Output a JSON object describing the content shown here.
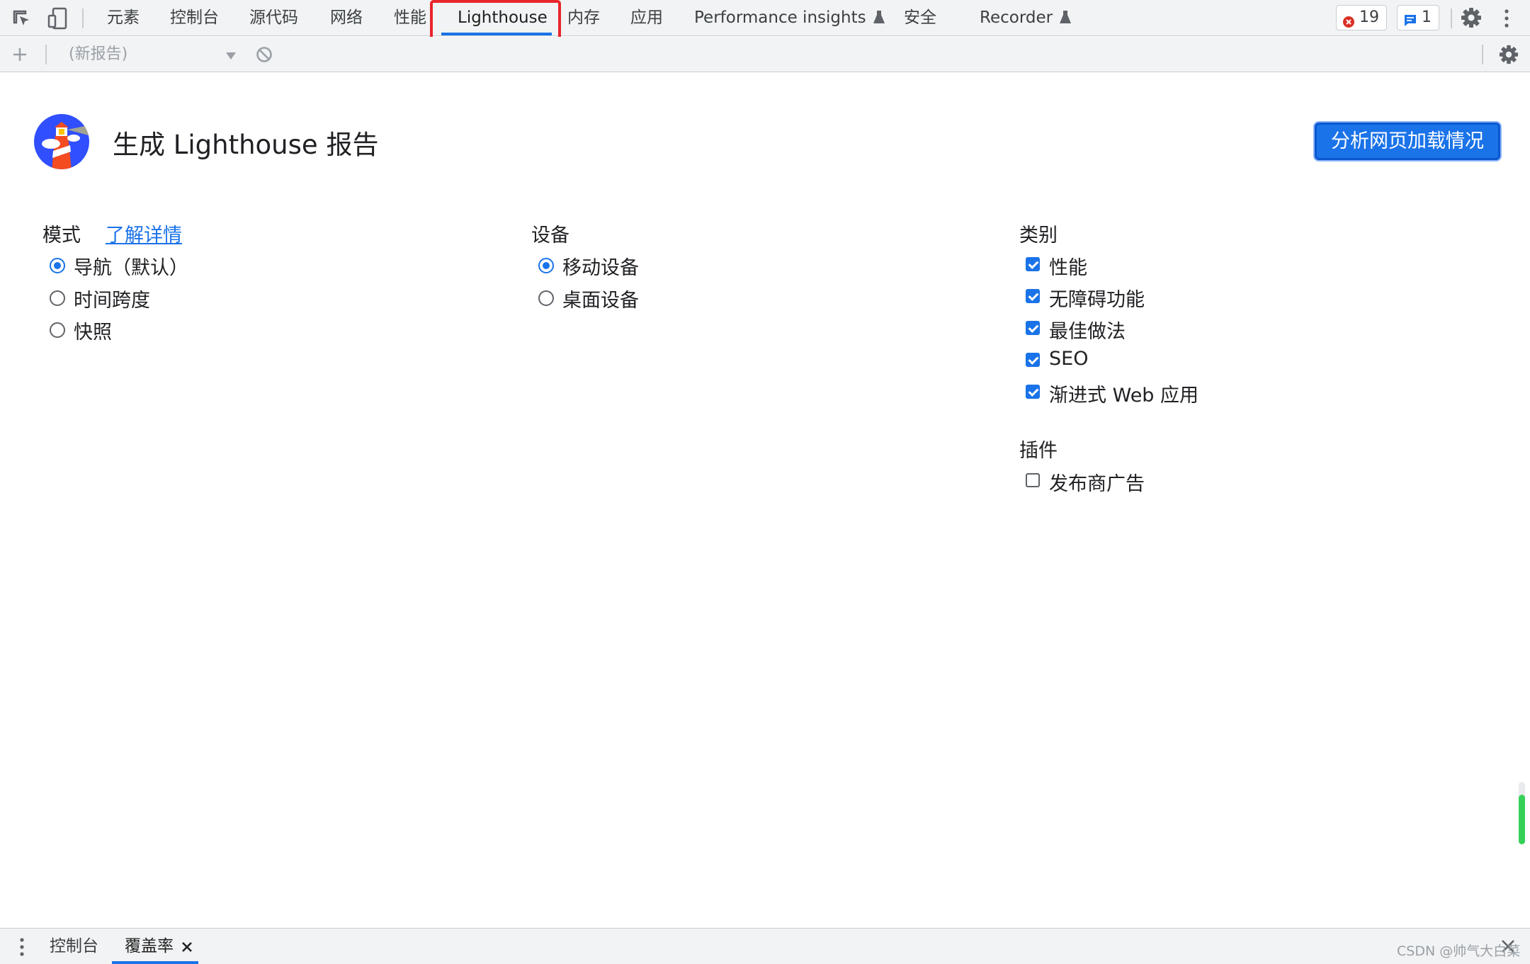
{
  "top_tabs": [
    {
      "label": "元素"
    },
    {
      "label": "控制台"
    },
    {
      "label": "源代码"
    },
    {
      "label": "网络"
    },
    {
      "label": "性能"
    },
    {
      "label": "Lighthouse",
      "active": true
    },
    {
      "label": "内存"
    },
    {
      "label": "应用"
    },
    {
      "label": "Performance insights",
      "experimental": true
    },
    {
      "label": "安全"
    },
    {
      "label": "Recorder",
      "experimental": true
    }
  ],
  "issues": {
    "errors": "19",
    "messages": "1"
  },
  "toolbar": {
    "report_select": "(新报告)"
  },
  "main": {
    "title": "生成 Lighthouse 报告",
    "analyze_button": "分析网页加载情况",
    "mode": {
      "label": "模式",
      "learn_more": "了解详情",
      "options": [
        {
          "label": "导航（默认）",
          "checked": true
        },
        {
          "label": "时间跨度",
          "checked": false
        },
        {
          "label": "快照",
          "checked": false
        }
      ]
    },
    "device": {
      "label": "设备",
      "options": [
        {
          "label": "移动设备",
          "checked": true
        },
        {
          "label": "桌面设备",
          "checked": false
        }
      ]
    },
    "categories": {
      "label": "类别",
      "items": [
        {
          "label": "性能",
          "checked": true
        },
        {
          "label": "无障碍功能",
          "checked": true
        },
        {
          "label": "最佳做法",
          "checked": true
        },
        {
          "label": "SEO",
          "checked": true
        },
        {
          "label": "渐进式 Web 应用",
          "checked": true
        }
      ]
    },
    "plugins": {
      "label": "插件",
      "items": [
        {
          "label": "发布商广告",
          "checked": false
        }
      ]
    }
  },
  "drawer": {
    "tabs": [
      {
        "label": "控制台"
      },
      {
        "label": "覆盖率",
        "active": true
      }
    ]
  },
  "watermark": "CSDN @帅气大白菜",
  "colors": {
    "accent": "#1a73e8",
    "highlight_box": "#e8262b",
    "error": "#d93025"
  }
}
